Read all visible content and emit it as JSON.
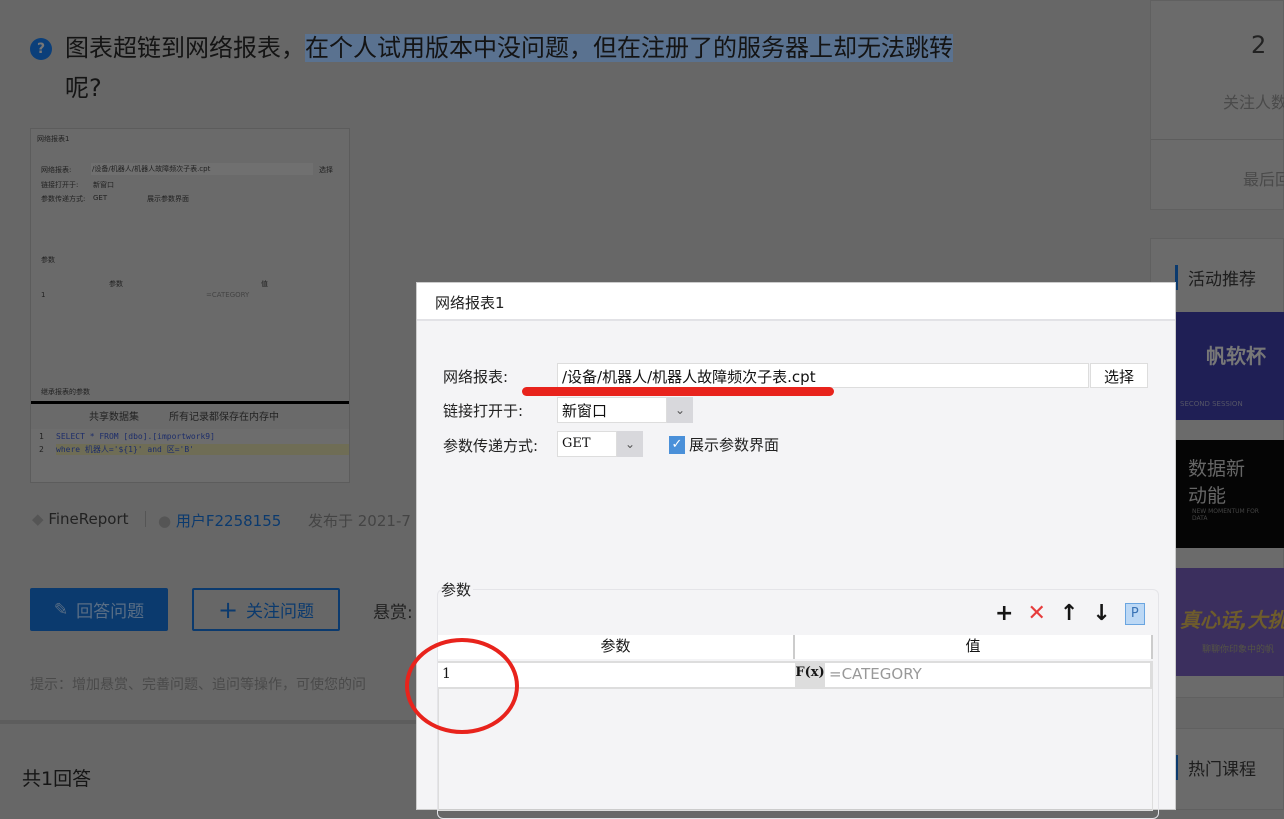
{
  "question": {
    "title_plain": "图表超链到网络报表，",
    "title_selected": "在个人试用版本中没问题，但在注册了的服务器上却无法跳转",
    "title_end": "呢?",
    "thumbnail": {
      "dialog_title": "网络报表1",
      "report_label": "网络报表:",
      "report_value": "/设备/机器人/机器人故障频次子表.cpt",
      "choose": "选择",
      "open_label": "链接打开于:",
      "open_value": "新窗口",
      "method_label": "参数传递方式:",
      "method_value": "GET",
      "show_params": "展示参数界面",
      "params_section": "参数",
      "col_param": "参数",
      "col_value": "值",
      "row_param": "1",
      "row_value": "=CATEGORY",
      "inherit": "继承报表的参数",
      "share": "共享数据集",
      "memory": "所有记录都保存在内存中",
      "code_line1_no": "1",
      "code_line1": "SELECT * FROM [dbo].[importwork9]",
      "code_line2_no": "2",
      "code_line2": "where 机器人='${1}' and 区='B'"
    },
    "tag": "FineReport",
    "user": "用户F2258155",
    "published": "发布于 2021-7",
    "answer_button": "回答问题",
    "follow_button": "关注问题",
    "bounty": "悬赏:",
    "tip": "提示：增加悬赏、完善问题、追问等操作，可使您的问"
  },
  "answers": {
    "count": "共1回答"
  },
  "sidebar": {
    "followers_count": "2",
    "followers_label": "关注人数",
    "last_label": "最后回",
    "activities_title": "活动推荐",
    "courses_title": "热门课程",
    "banners": [
      {
        "text": "帆软杯",
        "sub": "SECOND SESSION"
      },
      {
        "text": "数据新动能",
        "sub": "NEW MOMENTUM FOR DATA"
      },
      {
        "text": "真心话,大挑",
        "sub": "聊聊你印象中的帆"
      }
    ]
  },
  "dialog": {
    "title": "网络报表1",
    "report_label": "网络报表:",
    "report_value": "/设备/机器人/机器人故障频次子表.cpt",
    "choose_button": "选择",
    "open_label": "链接打开于:",
    "open_value": "新窗口",
    "method_label": "参数传递方式:",
    "method_value": "GET",
    "show_params_label": "展示参数界面",
    "show_params_checked": true,
    "params": {
      "title": "参数",
      "columns": [
        "参数",
        "值"
      ],
      "rows": [
        {
          "param": "1",
          "value": "=CATEGORY"
        }
      ],
      "formula_icon": "F(x)"
    }
  },
  "colors": {
    "annotation": "#e8231c",
    "accent": "#0b3a6e"
  }
}
